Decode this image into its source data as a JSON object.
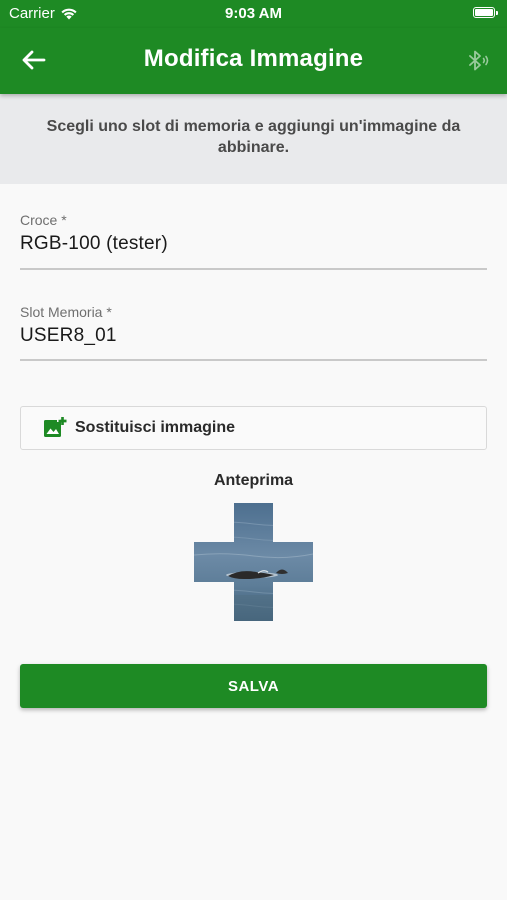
{
  "status_bar": {
    "carrier": "Carrier",
    "time": "9:03 AM",
    "wifi_icon": "wifi-icon",
    "battery_icon": "battery-icon",
    "battery_level": 1.0
  },
  "app_bar": {
    "title": "Modifica Immagine",
    "back_icon": "arrow-back-icon",
    "bluetooth_icon": "bluetooth-searching-icon",
    "background_color": "#1e8a24"
  },
  "banner": {
    "text": "Scegli uno slot di memoria e aggiungi un'immagine da abbinare."
  },
  "form": {
    "cross_field": {
      "label": "Croce *",
      "value": "RGB-100 (tester)"
    },
    "slot_field": {
      "label": "Slot Memoria *",
      "value": "USER8_01"
    }
  },
  "replace_button": {
    "label": "Sostituisci immagine",
    "icon": "add-photo-icon"
  },
  "preview": {
    "title": "Anteprima",
    "shape": "cross",
    "image_description_icon": "sea-photo-preview"
  },
  "save_button": {
    "label": "SALVA"
  },
  "colors": {
    "primary": "#1e8a24",
    "banner_bg": "#e9eaec",
    "page_bg": "#f9f9f9"
  }
}
